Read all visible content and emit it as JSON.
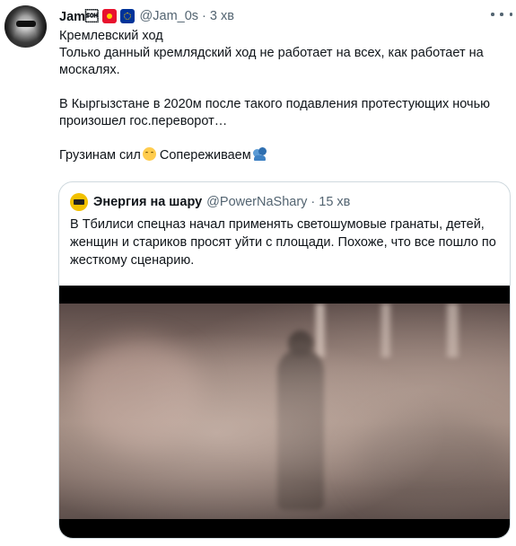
{
  "tweet": {
    "display_name": "Jam\u0001",
    "handle": "@Jam_0s",
    "separator": "·",
    "time": "3 хв",
    "flags": [
      "flag-kyrgyzstan-icon",
      "flag-eu-icon"
    ],
    "lines": [
      "Кремлевский ход",
      "Только данный кремлядский ход не работает на всех, как работает на москалях.",
      "",
      "В Кыргызстане в 2020м после такого подавления протестующих ночью произошел гос.переворот…",
      "",
      "Грузинам сил",
      "Сопереживаем"
    ],
    "emojis": [
      "relieved-face-emoji",
      "people-hugging-emoji"
    ]
  },
  "quote": {
    "display_name": "Энергия на шару",
    "handle": "@PowerNaShary",
    "separator": "·",
    "time": "15 хв",
    "text": "В Тбилиси спецназ начал применять светошумовые гранаты, детей, женщин и стариков просят уйти с площади. Похоже, что все пошло по жесткому сценарию."
  },
  "colors": {
    "text": "#0f1419",
    "secondary": "#536471",
    "border": "#cfd9de"
  }
}
